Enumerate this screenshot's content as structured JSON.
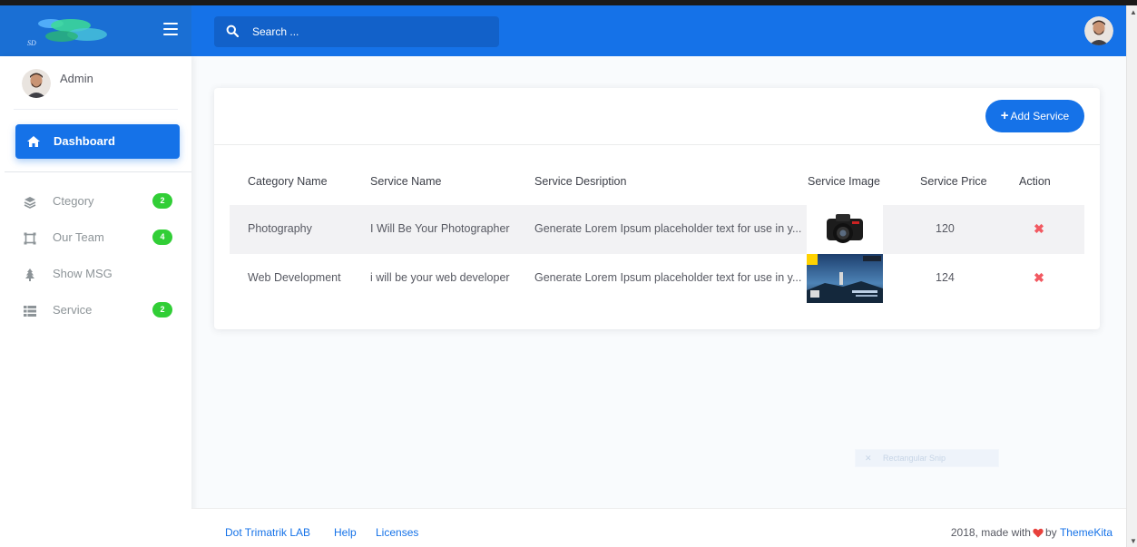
{
  "header": {
    "search_placeholder": "Search ..."
  },
  "sidebar": {
    "user_name": "Admin",
    "dashboard_label": "Dashboard",
    "items": [
      {
        "label": "Ctegory",
        "badge": "2",
        "icon": "layers-icon"
      },
      {
        "label": "Our Team",
        "badge": "4",
        "icon": "frame-icon"
      },
      {
        "label": "Show MSG",
        "badge": "",
        "icon": "tree-icon"
      },
      {
        "label": "Service",
        "badge": "2",
        "icon": "list-icon"
      }
    ]
  },
  "card": {
    "add_button_label": "Add Service",
    "columns": [
      "Category Name",
      "Service Name",
      "Service Desription",
      "Service Image",
      "Service Price",
      "Action"
    ],
    "rows": [
      {
        "category": "Photography",
        "service": "I Will Be Your Photographer",
        "description": "Generate Lorem Ipsum placeholder text for use in y...",
        "image": "camera-photo",
        "price": "120",
        "action_icon": "delete-icon"
      },
      {
        "category": "Web Development",
        "service": "i will be your web developer",
        "description": "Generate Lorem Ipsum placeholder text for use in y...",
        "image": "landscape-photo",
        "price": "124",
        "action_icon": "delete-icon"
      }
    ]
  },
  "overlay": {
    "snip_label": "Rectangular Snip"
  },
  "footer": {
    "links": [
      "Dot Trimatrik LAB",
      "Help",
      "Licenses"
    ],
    "copyright_prefix": "2018, made with",
    "copyright_by": "by",
    "copyright_brand": "ThemeKita"
  },
  "colors": {
    "primary": "#1572e8",
    "success_badge": "#31ce36",
    "danger": "#f25961",
    "heart": "#e8413c"
  }
}
